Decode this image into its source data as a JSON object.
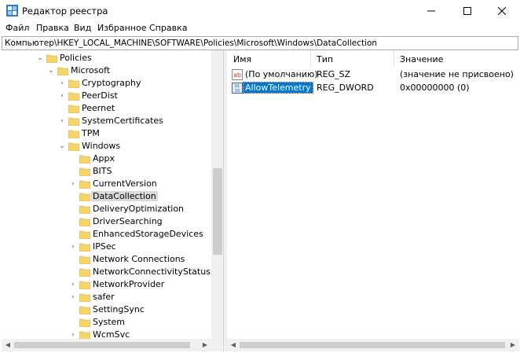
{
  "window": {
    "title": "Редактор реестра"
  },
  "menu": {
    "items": [
      "Файл",
      "Правка",
      "Вид",
      "Избранное",
      "Справка"
    ]
  },
  "address": {
    "path": "Компьютер\\HKEY_LOCAL_MACHINE\\SOFTWARE\\Policies\\Microsoft\\Windows\\DataCollection"
  },
  "tree": {
    "nodes": [
      {
        "label": "Policies",
        "expander": "⌄"
      },
      {
        "label": "Microsoft",
        "expander": "⌄"
      },
      {
        "label": "Cryptography",
        "expander": "›"
      },
      {
        "label": "PeerDist",
        "expander": "›"
      },
      {
        "label": "Peernet",
        "expander": ""
      },
      {
        "label": "SystemCertificates",
        "expander": "›"
      },
      {
        "label": "TPM",
        "expander": ""
      },
      {
        "label": "Windows",
        "expander": "⌄"
      },
      {
        "label": "Appx",
        "expander": ""
      },
      {
        "label": "BITS",
        "expander": ""
      },
      {
        "label": "CurrentVersion",
        "expander": "›"
      },
      {
        "label": "DataCollection",
        "expander": ""
      },
      {
        "label": "DeliveryOptimization",
        "expander": ""
      },
      {
        "label": "DriverSearching",
        "expander": ""
      },
      {
        "label": "EnhancedStorageDevices",
        "expander": ""
      },
      {
        "label": "IPSec",
        "expander": "›"
      },
      {
        "label": "Network Connections",
        "expander": ""
      },
      {
        "label": "NetworkConnectivityStatusIndi",
        "expander": ""
      },
      {
        "label": "NetworkProvider",
        "expander": "›"
      },
      {
        "label": "safer",
        "expander": "›"
      },
      {
        "label": "SettingSync",
        "expander": ""
      },
      {
        "label": "System",
        "expander": ""
      },
      {
        "label": "WcmSvc",
        "expander": "›"
      }
    ],
    "selected": "DataCollection"
  },
  "values": {
    "columns": {
      "name": "Имя",
      "type": "Тип",
      "data": "Значение"
    },
    "rows": [
      {
        "icon": "string-value-icon",
        "name": "(По умолчанию)",
        "type": "REG_SZ",
        "data": "(значение не присвоено)"
      },
      {
        "icon": "dword-value-icon",
        "name": "AllowTelemetry",
        "type": "REG_DWORD",
        "data": "0x00000000 (0)"
      }
    ]
  },
  "colors": {
    "folder": "#f5d56a",
    "selection": "#0078d7",
    "tree_selection": "#d9d9d9",
    "titlebar_icon": "#2b7bd3"
  }
}
